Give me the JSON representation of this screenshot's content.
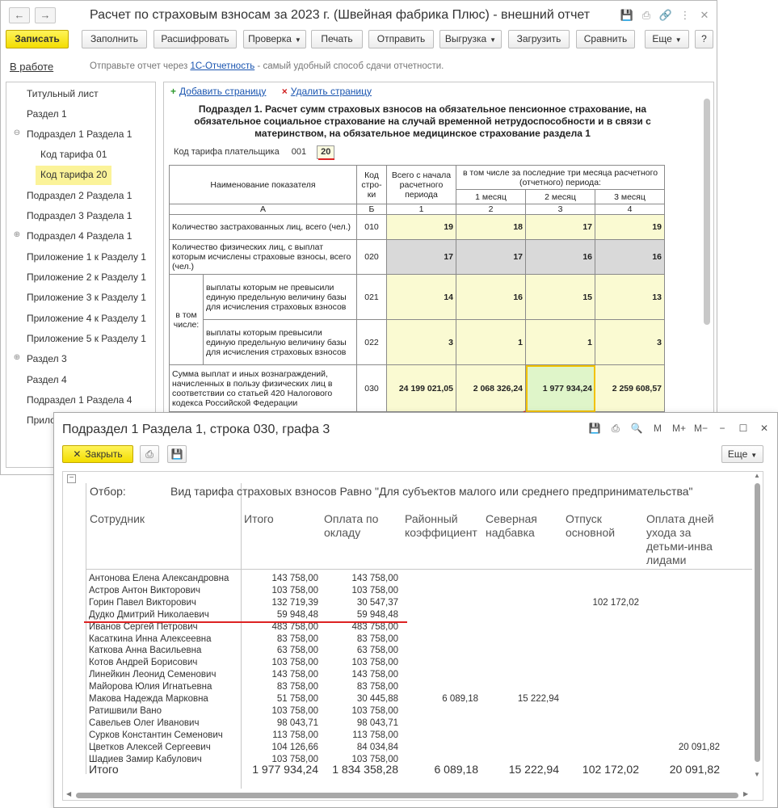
{
  "main": {
    "nav": {
      "back": "←",
      "forward": "→"
    },
    "title": "Расчет по страховым взносам за 2023 г. (Швейная фабрика Плюс) - внешний отчет",
    "toolbar": {
      "save": "Записать",
      "fill": "Заполнить",
      "decode": "Расшифровать",
      "check": "Проверка",
      "print": "Печать",
      "send": "Отправить",
      "upload": "Выгрузка",
      "load": "Загрузить",
      "compare": "Сравнить",
      "more": "Еще",
      "help": "?"
    },
    "status": "В работе",
    "hint_prefix": "Отправьте отчет через ",
    "hint_link": "1С-Отчетность",
    "hint_suffix": " - самый удобный способ сдачи отчетности."
  },
  "tree": [
    "Титульный лист",
    "Раздел 1",
    "Подраздел 1 Раздела 1",
    "Код тарифа 01",
    "Код тарифа 20",
    "Подраздел 2 Раздела 1",
    "Подраздел 3 Раздела 1",
    "Подраздел 4 Раздела 1",
    "Приложение 1 к Разделу 1",
    "Приложение 2 к Разделу 1",
    "Приложение 3 к Разделу 1",
    "Приложение 4 к Разделу 1",
    "Приложение 5 к Разделу 1",
    "Раздел 3",
    "Раздел 4",
    "Подраздел 1 Раздела 4",
    "Прило"
  ],
  "form": {
    "add_page": "Добавить страницу",
    "delete_page": "Удалить страницу",
    "title": "Подраздел 1. Расчет сумм страховых взносов на обязательное пенсионное страхование, на обязательное социальное страхование на случай временной нетрудоспособности и в связи с материнством, на обязательное медицинское страхование раздела 1",
    "tariff_label": "Код тарифа плательщика",
    "tariff_prefix": "001",
    "tariff_value": "20",
    "table": {
      "h_name": "Наименование показателя",
      "h_code": "Код стро-ки",
      "h_total": "Всего с начала расчетного периода",
      "h_last3": "в том числе за последние три месяца расчетного (отчетного) периода:",
      "h_m1": "1 месяц",
      "h_m2": "2 месяц",
      "h_m3": "3 месяц",
      "letters": [
        "А",
        "Б",
        "1",
        "2",
        "3",
        "4"
      ],
      "r010": {
        "label": "Количество застрахованных лиц, всего (чел.)",
        "code": "010",
        "v": [
          "19",
          "18",
          "17",
          "19"
        ]
      },
      "r020": {
        "label": "Количество физических лиц, с выплат которым исчислены страховые взносы, всего (чел.)",
        "code": "020",
        "v": [
          "17",
          "17",
          "16",
          "16"
        ]
      },
      "in_that": "в том числе:",
      "r021": {
        "label": "выплаты которым не превысили единую предельную величину базы для исчисления страховых взносов",
        "code": "021",
        "v": [
          "14",
          "16",
          "15",
          "13"
        ]
      },
      "r022": {
        "label": "выплаты которым превысили единую предельную величину базы для исчисления страховых взносов",
        "code": "022",
        "v": [
          "3",
          "1",
          "1",
          "3"
        ]
      },
      "r030": {
        "label": "Сумма выплат и иных вознаграждений, начисленных в пользу физических лиц в соответствии со статьей 420 Налогового кодекса Российской Федерации",
        "code": "030",
        "v": [
          "24 199 021,05",
          "2 068 326,24",
          "1 977 934,24",
          "2 259 608,57"
        ]
      }
    }
  },
  "popup": {
    "title": "Подраздел 1 Раздела 1, строка 030, графа 3",
    "icons": [
      "save-icon",
      "print-icon",
      "preview-icon",
      "M",
      "M+",
      "M−",
      "−",
      "☐",
      "✕"
    ],
    "close": "Закрыть",
    "more": "Еще",
    "filter_label": "Отбор:",
    "filter_value": "Вид тарифа страховых взносов Равно \"Для субъектов малого или среднего предпринимательства\"",
    "columns": [
      "Сотрудник",
      "Итого",
      "Оплата по окладу",
      "Районный коэффициент",
      "Северная надбавка",
      "Отпуск основной",
      "Оплата дней ухода за детьми-инва лидами"
    ],
    "rows": [
      {
        "name": "Антонова Елена Александровна",
        "total": "143 758,00",
        "salary": "143 758,00",
        "rk": "",
        "north": "",
        "vac": "",
        "care": ""
      },
      {
        "name": "Астров Антон Викторович",
        "total": "103 758,00",
        "salary": "103 758,00",
        "rk": "",
        "north": "",
        "vac": "",
        "care": ""
      },
      {
        "name": "Горин Павел Викторович",
        "total": "132 719,39",
        "salary": "30 547,37",
        "rk": "",
        "north": "",
        "vac": "102 172,02",
        "care": ""
      },
      {
        "name": "Дудко Дмитрий Николаевич",
        "total": "59 948,48",
        "salary": "59 948,48",
        "rk": "",
        "north": "",
        "vac": "",
        "care": ""
      },
      {
        "name": "Иванов Сергей Петрович",
        "total": "483 758,00",
        "salary": "483 758,00",
        "rk": "",
        "north": "",
        "vac": "",
        "care": ""
      },
      {
        "name": "Касаткина Инна Алексеевна",
        "total": "83 758,00",
        "salary": "83 758,00",
        "rk": "",
        "north": "",
        "vac": "",
        "care": ""
      },
      {
        "name": "Каткова Анна Васильевна",
        "total": "63 758,00",
        "salary": "63 758,00",
        "rk": "",
        "north": "",
        "vac": "",
        "care": ""
      },
      {
        "name": "Котов Андрей Борисович",
        "total": "103 758,00",
        "salary": "103 758,00",
        "rk": "",
        "north": "",
        "vac": "",
        "care": ""
      },
      {
        "name": "Линейкин Леонид Семенович",
        "total": "143 758,00",
        "salary": "143 758,00",
        "rk": "",
        "north": "",
        "vac": "",
        "care": ""
      },
      {
        "name": "Майорова Юлия Игнатьевна",
        "total": "83 758,00",
        "salary": "83 758,00",
        "rk": "",
        "north": "",
        "vac": "",
        "care": ""
      },
      {
        "name": "Макова Надежда Марковна",
        "total": "51 758,00",
        "salary": "30 445,88",
        "rk": "6 089,18",
        "north": "15 222,94",
        "vac": "",
        "care": ""
      },
      {
        "name": "Ратишвили Вано",
        "total": "103 758,00",
        "salary": "103 758,00",
        "rk": "",
        "north": "",
        "vac": "",
        "care": ""
      },
      {
        "name": "Савельев Олег Иванович",
        "total": "98 043,71",
        "salary": "98 043,71",
        "rk": "",
        "north": "",
        "vac": "",
        "care": ""
      },
      {
        "name": "Сурков Константин Семенович",
        "total": "113 758,00",
        "salary": "113 758,00",
        "rk": "",
        "north": "",
        "vac": "",
        "care": ""
      },
      {
        "name": "Цветков Алексей Сергеевич",
        "total": "104 126,66",
        "salary": "84 034,84",
        "rk": "",
        "north": "",
        "vac": "",
        "care": "20 091,82"
      },
      {
        "name": "Шадиев Замир Кабулович",
        "total": "103 758,00",
        "salary": "103 758,00",
        "rk": "",
        "north": "",
        "vac": "",
        "care": ""
      }
    ],
    "totals": {
      "label": "Итого",
      "total": "1 977 934,24",
      "salary": "1 834 358,28",
      "rk": "6 089,18",
      "north": "15 222,94",
      "vac": "102 172,02",
      "care": "20 091,82"
    }
  },
  "colors": {
    "accent_yellow": "#f3dd00",
    "selection": "#fbf399",
    "link": "#1a55b0",
    "annotation_red": "#d22222"
  }
}
